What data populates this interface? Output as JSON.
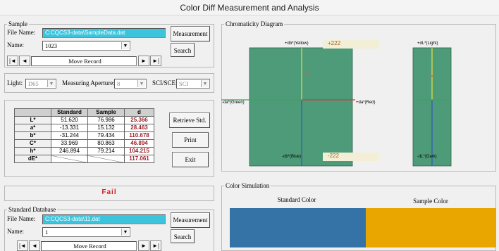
{
  "window": {
    "title": "Color Diff Measurement and Analysis"
  },
  "sample": {
    "group_title": "Sample",
    "file_name_label": "File Name:",
    "file_name_value": "C:CQCS3-data\\SampleData.dat",
    "name_label": "Name:",
    "name_value": "1023",
    "measurement_button": "Measurement",
    "search_button": "Search",
    "nav_label": "Move Record",
    "nav_first": "|◄",
    "nav_prev": "◄",
    "nav_next": "►",
    "nav_last": "►|"
  },
  "settings": {
    "light_label": "Light:",
    "light_value": "D65",
    "aperture_label": "Measuring Aperture:",
    "aperture_value": "8",
    "scisce_label": "SCI/SCE:",
    "scisce_value": "SCI"
  },
  "color_table": {
    "headers": [
      "",
      "Standard",
      "Sample",
      "d"
    ],
    "rows": [
      {
        "label": "L*",
        "standard": "51.620",
        "sample": "76.986",
        "d": "25.366"
      },
      {
        "label": "a*",
        "standard": "-13.331",
        "sample": "15.132",
        "d": "28.463"
      },
      {
        "label": "b*",
        "standard": "-31.244",
        "sample": "79.434",
        "d": "110.678"
      },
      {
        "label": "C*",
        "standard": "33.969",
        "sample": "80.863",
        "d": "46.894"
      },
      {
        "label": "h*",
        "standard": "246.894",
        "sample": "79.214",
        "d": "104.215"
      },
      {
        "label": "dE*",
        "standard": "",
        "sample": "",
        "d": "117.061"
      }
    ]
  },
  "actions": {
    "retrieve": "Retrieve Std.",
    "print": "Print",
    "exit": "Exit"
  },
  "result": {
    "text": "Fail",
    "color": "#d42020"
  },
  "standard_db": {
    "group_title": "Standard Database",
    "file_name_label": "File Name:",
    "file_name_value": "C:CQCS3-data\\11.dat",
    "name_label": "Name:",
    "name_value": "1",
    "measurement_button": "Measurement",
    "search_button": "Search",
    "nav_label": "Move Record",
    "nav_first": "|◄",
    "nav_prev": "◄",
    "nav_next": "►",
    "nav_last": "►|"
  },
  "chromaticity": {
    "group_title": "Chromaticity Diagram",
    "yellow_label": "+db*(Yellow)",
    "blue_label": "-db*(Blue)",
    "green_label": "-da*(Green)",
    "red_label": "+da*(Red)",
    "range_top": "+222",
    "range_bottom": "-222",
    "light_label": "+dL*(Light)",
    "dark_label": "-dL*(Dark)",
    "marker": "×",
    "panel_color": "#4e9b7a"
  },
  "simulation": {
    "group_title": "Color Simulation",
    "standard_label": "Standard Color",
    "sample_label": "Sample Color",
    "standard_color": "#3572a5",
    "sample_color": "#e9a500"
  }
}
